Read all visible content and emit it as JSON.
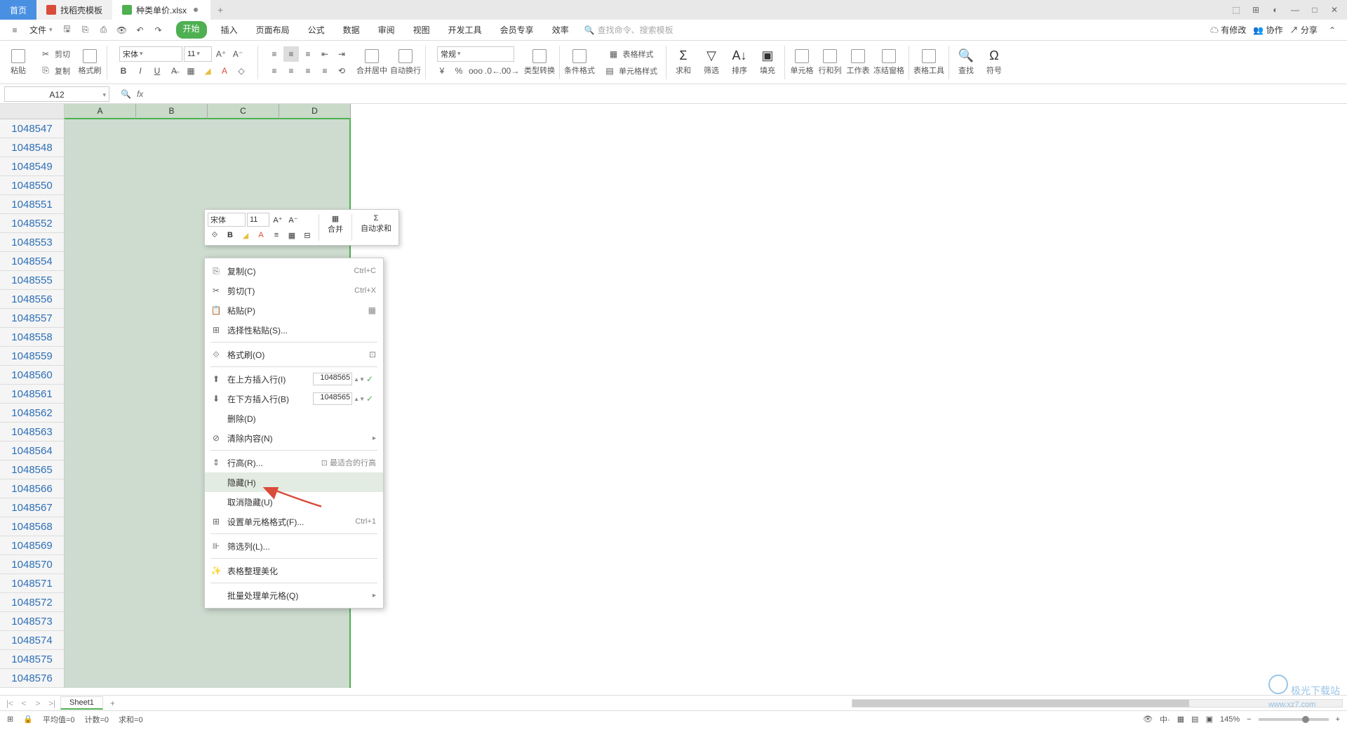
{
  "titlebar": {
    "home": "首页",
    "template": "找稻壳模板",
    "file": "种类单价.xlsx",
    "add": "+"
  },
  "menubar": {
    "file_btn": "文件",
    "tabs": [
      "开始",
      "插入",
      "页面布局",
      "公式",
      "数据",
      "审阅",
      "视图",
      "开发工具",
      "会员专享",
      "效率"
    ],
    "search_placeholder": "查找命令、搜索模板",
    "right": {
      "changes": "有修改",
      "collab": "协作",
      "share": "分享"
    }
  },
  "ribbon": {
    "paste": "粘贴",
    "cut": "剪切",
    "copy": "复制",
    "format_painter": "格式刷",
    "font": "宋体",
    "size": "11",
    "merge": "合并居中",
    "wrap": "自动换行",
    "numfmt": "常规",
    "type_convert": "类型转换",
    "cond_fmt": "条件格式",
    "table_style": "表格样式",
    "cell_style": "单元格样式",
    "sum": "求和",
    "filter": "筛选",
    "sort": "排序",
    "fill": "填充",
    "cells": "单元格",
    "rowscols": "行和列",
    "worksheet": "工作表",
    "freeze": "冻结窗格",
    "table_tools": "表格工具",
    "find": "查找",
    "symbol": "符号"
  },
  "formula_bar": {
    "name_box": "A12",
    "fx": "fx"
  },
  "grid": {
    "cols": [
      "A",
      "B",
      "C",
      "D"
    ],
    "rows": [
      "1048547",
      "1048548",
      "1048549",
      "1048550",
      "1048551",
      "1048552",
      "1048553",
      "1048554",
      "1048555",
      "1048556",
      "1048557",
      "1048558",
      "1048559",
      "1048560",
      "1048561",
      "1048562",
      "1048563",
      "1048564",
      "1048565",
      "1048566",
      "1048567",
      "1048568",
      "1048569",
      "1048570",
      "1048571",
      "1048572",
      "1048573",
      "1048574",
      "1048575",
      "1048576"
    ]
  },
  "mini_toolbar": {
    "font": "宋体",
    "size": "11",
    "merge": "合并",
    "autosum": "自动求和"
  },
  "context_menu": {
    "copy": "复制(C)",
    "copy_sc": "Ctrl+C",
    "cut": "剪切(T)",
    "cut_sc": "Ctrl+X",
    "paste": "粘贴(P)",
    "paste_special": "选择性粘贴(S)...",
    "format_painter": "格式刷(O)",
    "insert_above": "在上方插入行(I)",
    "insert_above_val": "1048565",
    "insert_below": "在下方插入行(B)",
    "insert_below_val": "1048565",
    "delete": "删除(D)",
    "clear": "清除内容(N)",
    "row_height": "行高(R)...",
    "best_fit": "最适合的行高",
    "hide": "隐藏(H)",
    "unhide": "取消隐藏(U)",
    "format_cells": "设置单元格格式(F)...",
    "format_cells_sc": "Ctrl+1",
    "filter_col": "筛选列(L)...",
    "beautify": "表格整理美化",
    "batch": "批量处理单元格(Q)"
  },
  "sheet_tabs": {
    "sheet1": "Sheet1"
  },
  "status_bar": {
    "avg": "平均值=0",
    "count": "计数=0",
    "sum": "求和=0",
    "zoom": "145%"
  },
  "watermark": {
    "line1": "极光下载站",
    "line2": "www.xz7.com"
  }
}
